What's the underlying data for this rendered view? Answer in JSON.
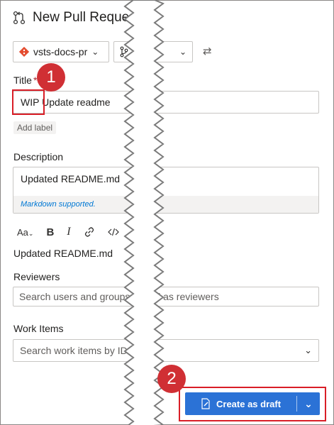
{
  "header": {
    "title": "New Pull Request"
  },
  "repo_selector": {
    "value": "vsts-docs-pr"
  },
  "branch_selector": {
    "value": ""
  },
  "form": {
    "title_label": "Title",
    "required_mark": "*",
    "title_value": "WIP Update readme",
    "add_label": "Add label",
    "description_label": "Description",
    "description_value": "Updated README.md",
    "markdown_hint": "Markdown supported.",
    "toolbar": {
      "heading": "Aa",
      "bold": "B",
      "italic": "I"
    },
    "preview_text": "Updated README.md",
    "reviewers_label": "Reviewers",
    "reviewers_placeholder": "Search users and groups to add as reviewers",
    "work_items_label": "Work Items",
    "work_items_placeholder": "Search work items by ID or title"
  },
  "actions": {
    "create_label": "Create as draft"
  },
  "callouts": {
    "first": "1",
    "second": "2"
  },
  "colors": {
    "accent": "#2b72d6",
    "callout": "#d02f34",
    "highlight": "#d91e27",
    "git": "#e44c2f"
  },
  "icons": {
    "pull_request": "pull-request-icon",
    "repo": "git-repo-icon",
    "branch": "branch-icon",
    "swap": "swap-arrows-icon",
    "link": "link-icon",
    "code": "code-icon",
    "draft": "draft-icon",
    "chevron": "chevron-down-icon"
  }
}
